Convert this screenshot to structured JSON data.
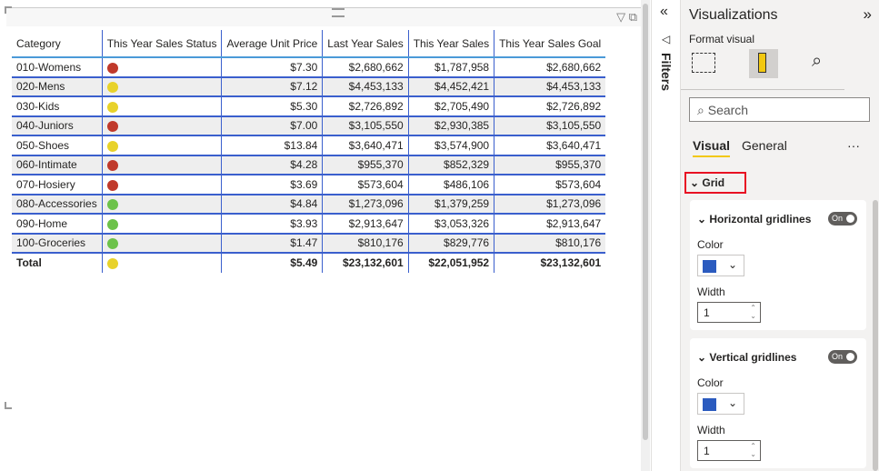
{
  "table": {
    "headers": [
      "Category",
      "This Year Sales Status",
      "Average Unit Price",
      "Last Year Sales",
      "This Year Sales",
      "This Year Sales Goal"
    ],
    "rows": [
      [
        "010-Womens",
        "red",
        "$7.30",
        "$2,680,662",
        "$1,787,958",
        "$2,680,662"
      ],
      [
        "020-Mens",
        "yellow",
        "$7.12",
        "$4,453,133",
        "$4,452,421",
        "$4,453,133"
      ],
      [
        "030-Kids",
        "yellow",
        "$5.30",
        "$2,726,892",
        "$2,705,490",
        "$2,726,892"
      ],
      [
        "040-Juniors",
        "red",
        "$7.00",
        "$3,105,550",
        "$2,930,385",
        "$3,105,550"
      ],
      [
        "050-Shoes",
        "yellow",
        "$13.84",
        "$3,640,471",
        "$3,574,900",
        "$3,640,471"
      ],
      [
        "060-Intimate",
        "red",
        "$4.28",
        "$955,370",
        "$852,329",
        "$955,370"
      ],
      [
        "070-Hosiery",
        "red",
        "$3.69",
        "$573,604",
        "$486,106",
        "$573,604"
      ],
      [
        "080-Accessories",
        "green",
        "$4.84",
        "$1,273,096",
        "$1,379,259",
        "$1,273,096"
      ],
      [
        "090-Home",
        "green",
        "$3.93",
        "$2,913,647",
        "$3,053,326",
        "$2,913,647"
      ],
      [
        "100-Groceries",
        "green",
        "$1.47",
        "$810,176",
        "$829,776",
        "$810,176"
      ]
    ],
    "total": [
      "Total",
      "yellow",
      "$5.49",
      "$23,132,601",
      "$22,051,952",
      "$23,132,601"
    ],
    "status_colors": {
      "red": "#c0392b",
      "yellow": "#e8d22a",
      "green": "#6cc24a"
    }
  },
  "filters": {
    "label": "Filters"
  },
  "pane": {
    "title": "Visualizations",
    "subtitle": "Format visual",
    "search_placeholder": "Search",
    "tabs": [
      "Visual",
      "General"
    ],
    "more": "···",
    "section": "Grid",
    "horizontal": {
      "title": "Horizontal gridlines",
      "toggle": "On",
      "color_label": "Color",
      "color": "#2b5bbf",
      "width_label": "Width",
      "width": "1"
    },
    "vertical": {
      "title": "Vertical gridlines",
      "toggle": "On",
      "color_label": "Color",
      "color": "#2b5bbf",
      "width_label": "Width",
      "width": "1"
    }
  }
}
